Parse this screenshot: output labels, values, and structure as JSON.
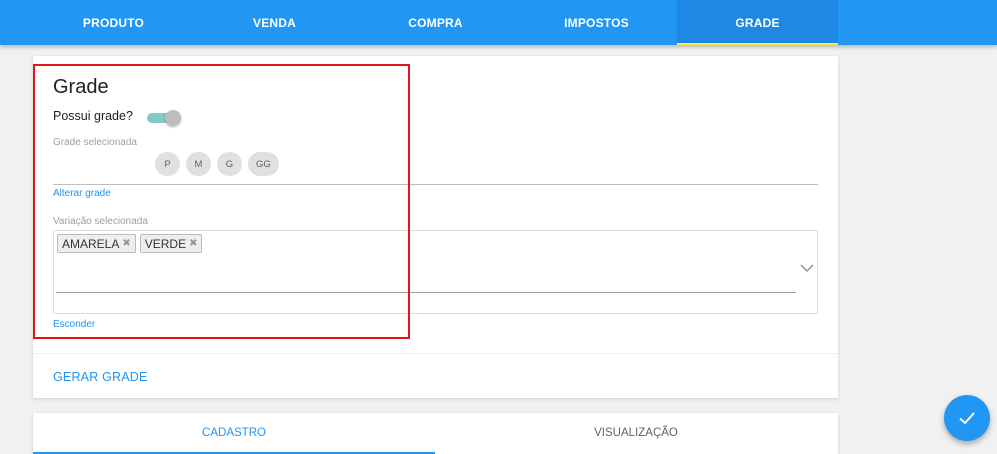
{
  "nav": {
    "tabs": [
      {
        "label": "PRODUTO"
      },
      {
        "label": "VENDA"
      },
      {
        "label": "COMPRA"
      },
      {
        "label": "IMPOSTOS"
      },
      {
        "label": "GRADE",
        "active": true
      }
    ]
  },
  "grade": {
    "title": "Grade",
    "possui_label": "Possui grade?",
    "possui_value": true,
    "grade_selecionada_label": "Grade selecionada",
    "sizes": [
      "P",
      "M",
      "G",
      "GG"
    ],
    "alterar_link": "Alterar grade",
    "variacao_label": "Variação selecionada",
    "variacoes": [
      "AMARELA",
      "VERDE"
    ],
    "remove_glyph": "✖",
    "esconder_link": "Esconder"
  },
  "actions": {
    "gerar_label": "GERAR GRADE"
  },
  "bottom_tabs": [
    {
      "label": "CADASTRO",
      "active": true
    },
    {
      "label": "VISUALIZAÇÃO"
    }
  ],
  "colors": {
    "primary": "#2196f3",
    "active_indicator": "#ffeb3b",
    "highlight": "#e3151a"
  },
  "icons": {
    "fab": "check-icon",
    "select": "chevron-down-icon",
    "tag_remove": "close-icon"
  }
}
